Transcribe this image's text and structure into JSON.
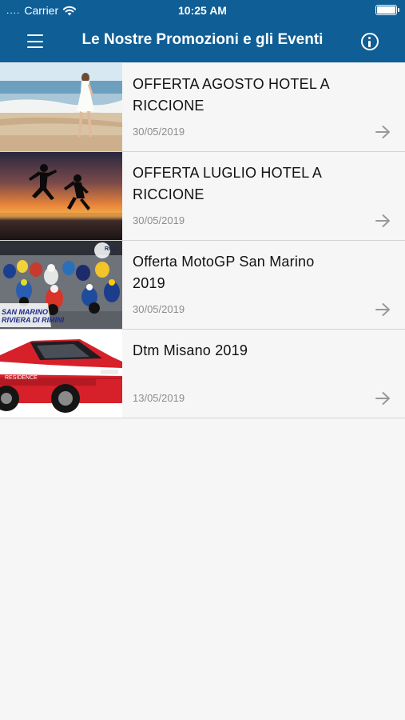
{
  "status_bar": {
    "signal_dots": "....",
    "carrier": "Carrier",
    "time": "10:25 AM"
  },
  "nav": {
    "title": "Le Nostre Promozioni e gli Eventi",
    "menu_icon": "hamburger-icon",
    "info_icon": "info-icon"
  },
  "colors": {
    "header": "#0f5e95",
    "background": "#f6f6f6",
    "divider": "#d4d4d4",
    "date_text": "#8c8c8c",
    "arrow": "#999999"
  },
  "promotions": [
    {
      "title": "OFFERTA AGOSTO HOTEL A RICCIONE",
      "date": "30/05/2019",
      "image": "beach-woman-photo"
    },
    {
      "title": "OFFERTA LUGLIO HOTEL A RICCIONE",
      "date": "30/05/2019",
      "image": "sunset-jumping-couple-photo"
    },
    {
      "title": "Offerta MotoGP San Marino 2019",
      "date": "30/05/2019",
      "image": "motogp-race-photo",
      "image_text": "SAN MARINO\nRIVIERA DI RIMINI"
    },
    {
      "title": "Dtm Misano 2019",
      "date": "13/05/2019",
      "image": "dtm-race-car-photo",
      "image_text": "Riccione\nRESIDENCE"
    }
  ]
}
